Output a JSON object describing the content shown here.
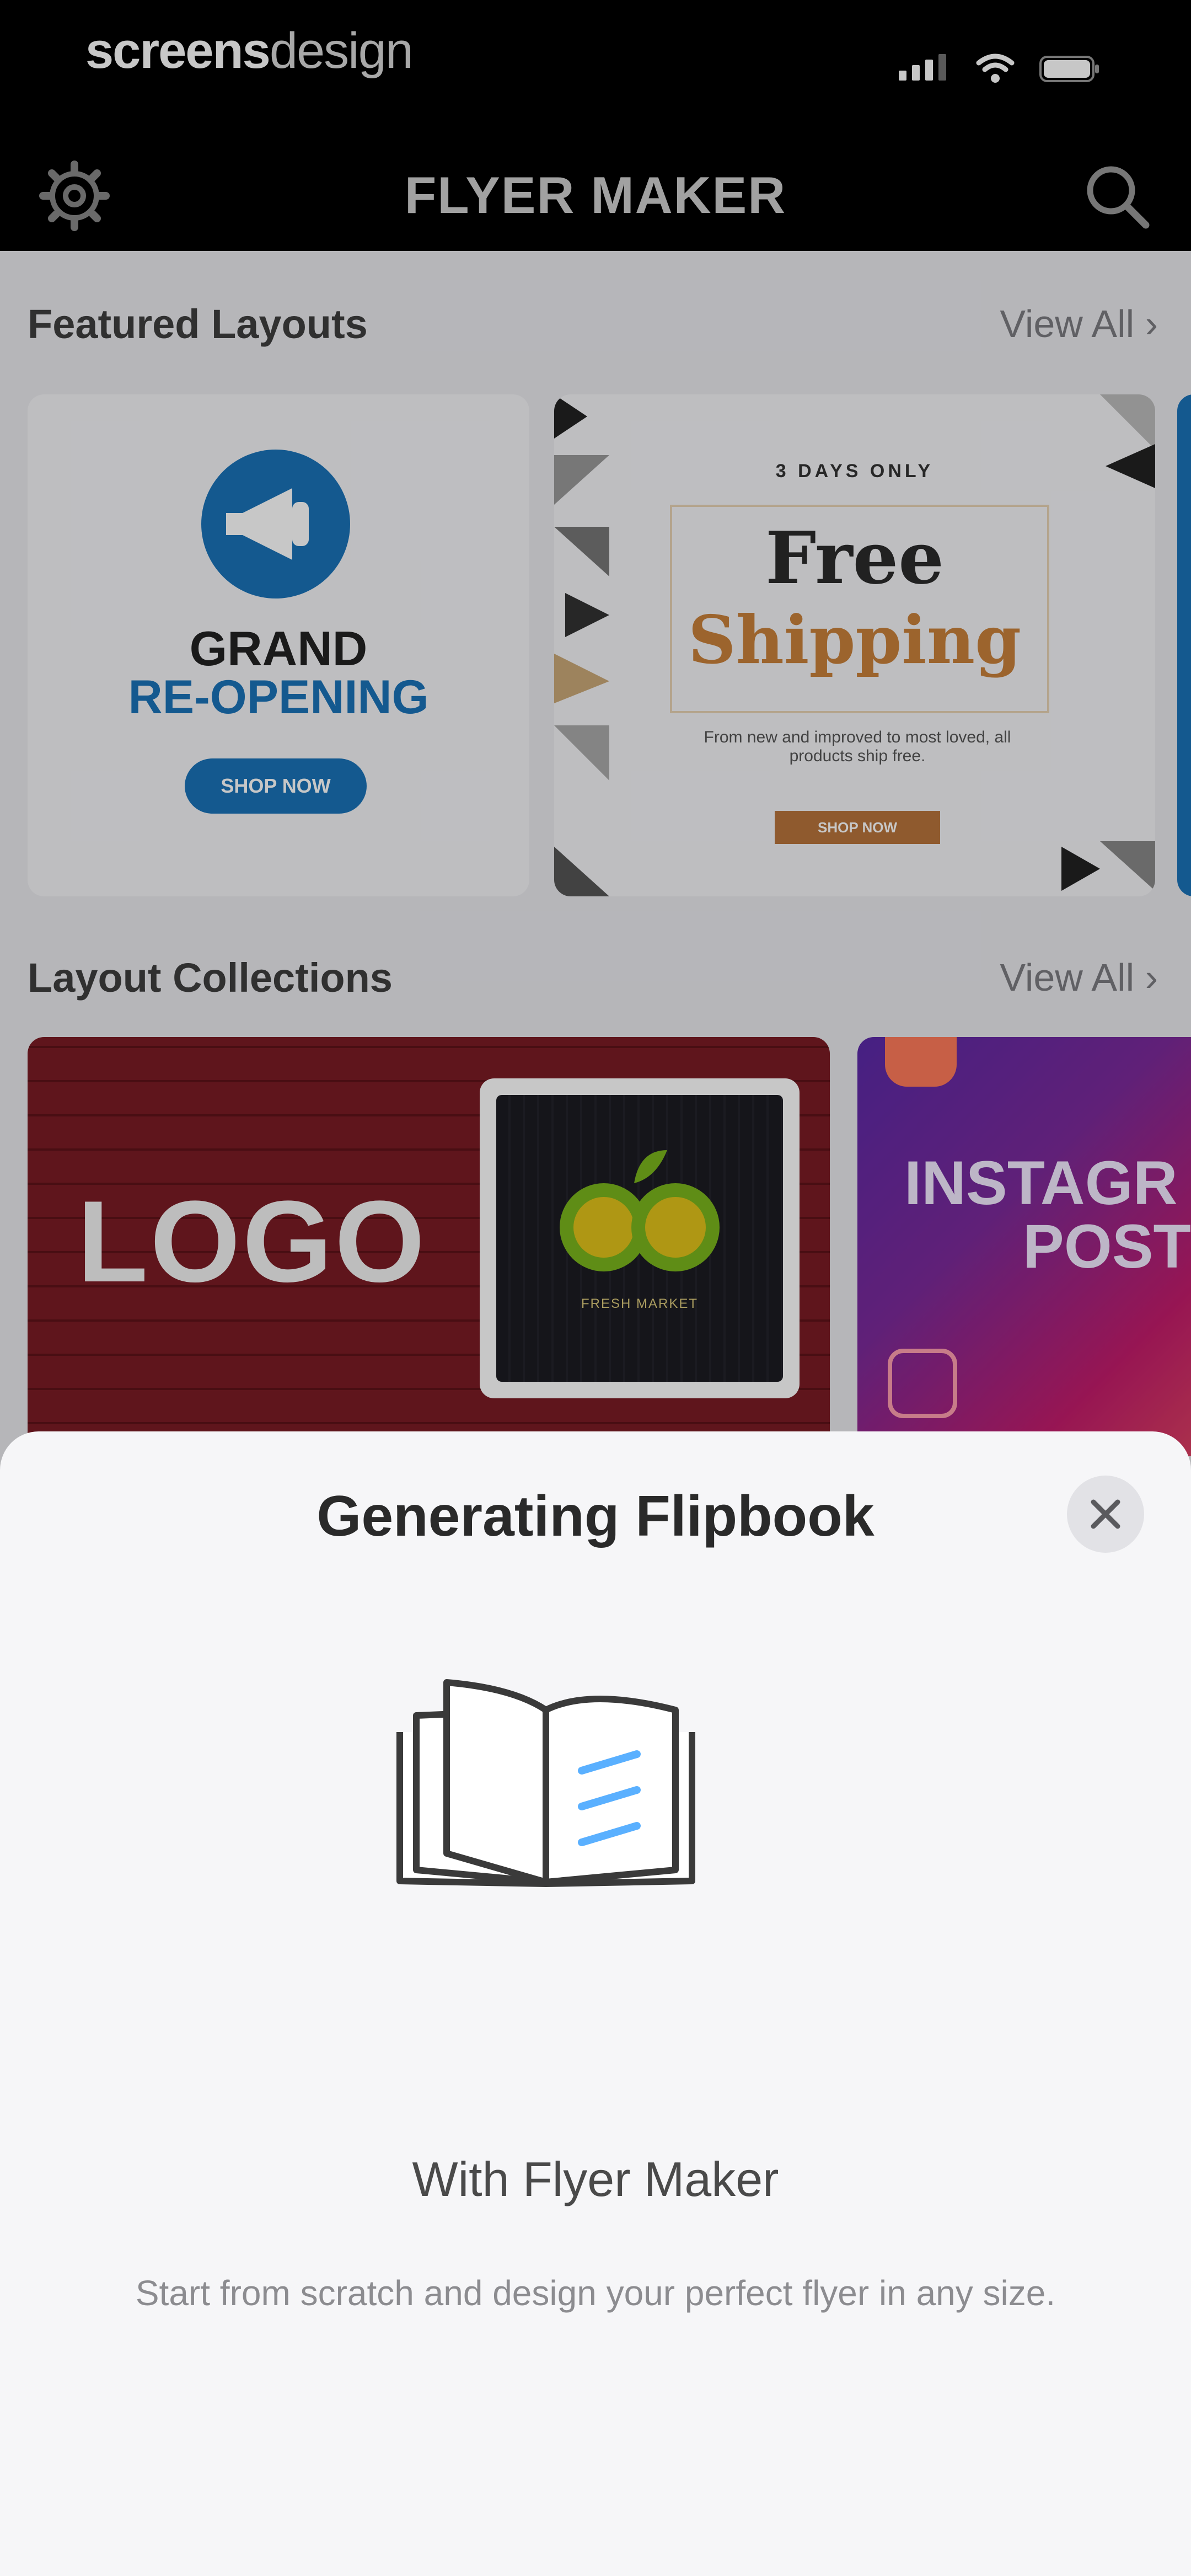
{
  "status_bar": {
    "brand_bold": "screens",
    "brand_light": "design"
  },
  "nav": {
    "title": "FLYER MAKER"
  },
  "featured": {
    "title": "Featured Layouts",
    "view_all": "View All",
    "cards": [
      {
        "line1": "GRAND",
        "line2": "RE-OPENING",
        "button": "SHOP NOW"
      },
      {
        "tag": "3 DAYS ONLY",
        "line1": "Free",
        "line2": "Shipping",
        "body": "From new and improved to most loved, all products ship free.",
        "button": "SHOP NOW"
      }
    ]
  },
  "collections": {
    "title": "Layout Collections",
    "view_all": "View All",
    "items": [
      {
        "label": "LOGO",
        "thumb_caption": "FRESH MARKET"
      },
      {
        "label_line1": "INSTAGR",
        "label_line2": "POST"
      }
    ]
  },
  "sheet": {
    "title": "Generating Flipbook",
    "subtitle": "With Flyer Maker",
    "description": "Start from scratch and design your perfect flyer in any size."
  },
  "colors": {
    "brand_blue": "#1a73b8",
    "shipping_orange": "#c8813a",
    "logo_red": "#7a1c24"
  }
}
